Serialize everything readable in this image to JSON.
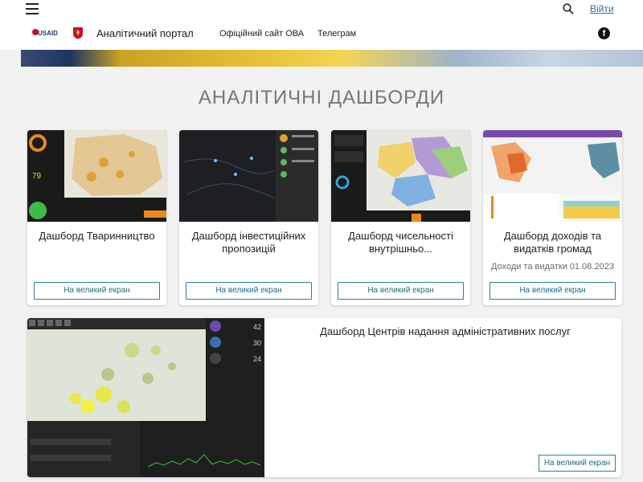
{
  "header": {
    "login_label": "Війти",
    "usaid_label": "USAID",
    "portal_title": "Аналітичний портал",
    "nav": [
      "Офіційний сайт ОВА",
      "Телеграм"
    ]
  },
  "section_title": "АНАЛІТИЧНІ ДАШБОРДИ",
  "cards": [
    {
      "title": "Дашборд Тваринництво",
      "subtitle": "",
      "button": "На великий екран",
      "thumb_value": "79"
    },
    {
      "title": "Дашборд інвестиційних пропозицій",
      "subtitle": "",
      "button": "На великий екран"
    },
    {
      "title": "Дашборд чисельності внутрішньо...",
      "subtitle": "",
      "button": "На великий екран"
    },
    {
      "title": "Дашборд доходів та видатків громад",
      "subtitle": "Доходи та видатки 01.08.2023",
      "button": "На великий екран"
    }
  ],
  "wide_card": {
    "title": "Дашборд Центрів надання адміністративних послуг",
    "button": "На великий екран",
    "stats": [
      "42",
      "30",
      "24"
    ]
  },
  "colors": {
    "accent": "#2a7f95",
    "link": "#2e6ea8"
  }
}
